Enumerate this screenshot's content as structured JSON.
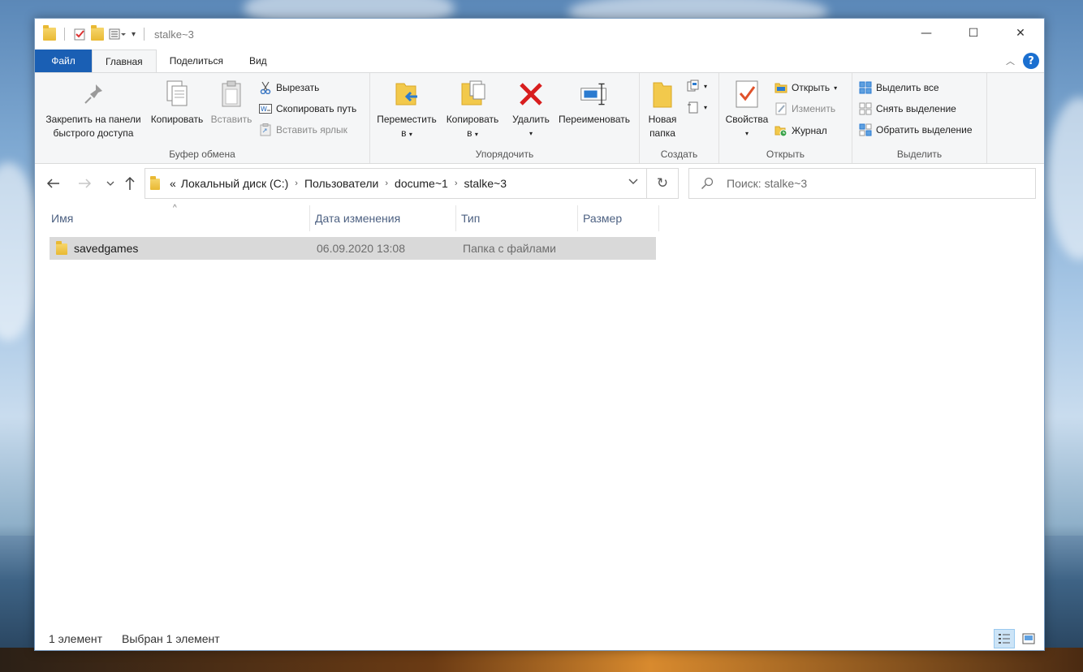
{
  "window": {
    "title": "stalke~3",
    "controls": {
      "minimize": "—",
      "maximize": "☐",
      "close": "✕"
    }
  },
  "tabs": [
    {
      "label": "Файл"
    },
    {
      "label": "Главная"
    },
    {
      "label": "Поделиться"
    },
    {
      "label": "Вид"
    }
  ],
  "ribbon": {
    "clipboard": {
      "label": "Буфер обмена",
      "pin": "Закрепить на панели быстрого доступа",
      "pin_line1": "Закрепить на панели",
      "pin_line2": "быстрого доступа",
      "copy": "Копировать",
      "paste": "Вставить",
      "cut": "Вырезать",
      "copy_path": "Скопировать путь",
      "paste_shortcut": "Вставить ярлык"
    },
    "organize": {
      "label": "Упорядочить",
      "move_line1": "Переместить",
      "move_line2": "в",
      "copy_line1": "Копировать",
      "copy_line2": "в",
      "delete": "Удалить",
      "rename": "Переименовать"
    },
    "new": {
      "label": "Создать",
      "new_folder_line1": "Новая",
      "new_folder_line2": "папка"
    },
    "open": {
      "label": "Открыть",
      "properties": "Свойства",
      "open": "Открыть",
      "edit": "Изменить",
      "history": "Журнал"
    },
    "select": {
      "label": "Выделить",
      "select_all": "Выделить все",
      "select_none": "Снять выделение",
      "invert": "Обратить выделение"
    }
  },
  "address": {
    "prefix": "«",
    "crumbs": [
      "Локальный диск (C:)",
      "Пользователи",
      "docume~1",
      "stalke~3"
    ]
  },
  "search": {
    "placeholder": "Поиск: stalke~3"
  },
  "columns": [
    "Имя",
    "Дата изменения",
    "Тип",
    "Размер"
  ],
  "files": [
    {
      "name": "savedgames",
      "modified": "06.09.2020 13:08",
      "type": "Папка с файлами",
      "size": ""
    }
  ],
  "status": {
    "count": "1 элемент",
    "selected": "Выбран 1 элемент"
  },
  "colors": {
    "file_tab": "#1a5fb4",
    "selection": "#d9d9d9",
    "help": "#1a6fd0",
    "folder": "#e9b933",
    "delete": "#d81e1e"
  }
}
